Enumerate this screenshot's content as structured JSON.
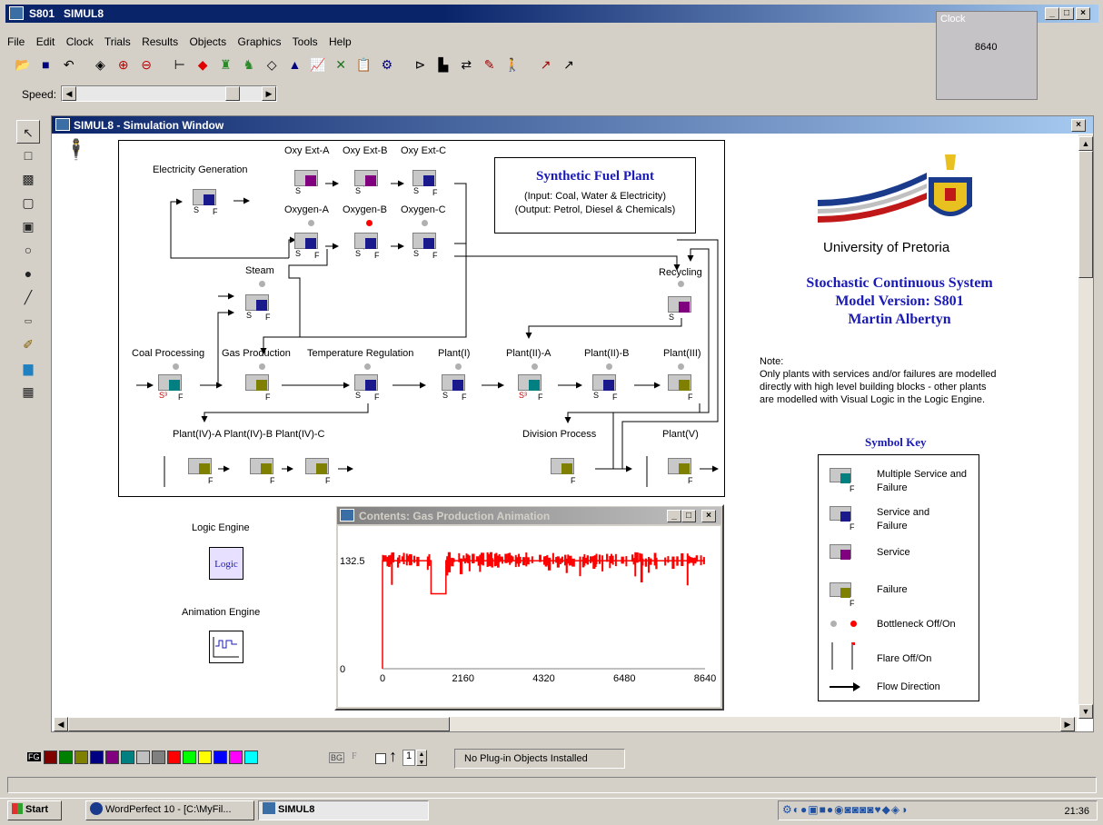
{
  "app": {
    "window_title": "S801   SIMUL8"
  },
  "clock": {
    "label": "Clock",
    "value": "8640"
  },
  "menu": [
    "File",
    "Edit",
    "Clock",
    "Trials",
    "Results",
    "Objects",
    "Graphics",
    "Tools",
    "Help"
  ],
  "speed": {
    "label": "Speed:"
  },
  "sim_window": {
    "title": "SIMUL8 - Simulation Window"
  },
  "plant": {
    "title": "Synthetic Fuel Plant",
    "input": "(Input: Coal, Water & Electricity)",
    "output": "(Output: Petrol, Diesel & Chemicals)"
  },
  "nodes": {
    "electricity": "Electricity Generation",
    "oxy_ext_a": "Oxy Ext-A",
    "oxy_ext_b": "Oxy Ext-B",
    "oxy_ext_c": "Oxy Ext-C",
    "oxygen_a": "Oxygen-A",
    "oxygen_b": "Oxygen-B",
    "oxygen_c": "Oxygen-C",
    "steam": "Steam",
    "recycling": "Recycling",
    "coal": "Coal Processing",
    "gas": "Gas Production",
    "temp": "Temperature Regulation",
    "plant1": "Plant(I)",
    "plant2a": "Plant(II)-A",
    "plant2b": "Plant(II)-B",
    "plant3": "Plant(III)",
    "plant4": "Plant(IV)-A Plant(IV)-B Plant(IV)-C",
    "division": "Division Process",
    "plant5": "Plant(V)"
  },
  "university": {
    "name": "University of Pretoria",
    "line1": "Stochastic Continuous System",
    "line2": "Model Version: S801",
    "line3": "Martin Albertyn"
  },
  "note": {
    "heading": "Note:",
    "l1": "Only plants with services and/or failures are modelled",
    "l2": "directly with high level building blocks - other plants",
    "l3": "are modelled with Visual Logic in the Logic Engine."
  },
  "symbol_key": {
    "title": "Symbol Key",
    "items": [
      "Multiple Service and Failure",
      "Service and Failure",
      "Service",
      "Failure",
      "Bottleneck Off/On",
      "Flare Off/On",
      "Flow Direction"
    ]
  },
  "engines": {
    "logic": "Logic Engine",
    "logic_icon": "Logic",
    "animation": "Animation Engine"
  },
  "chart_window": {
    "title": "Contents: Gas Production Animation"
  },
  "chart_data": {
    "type": "line",
    "title": "Contents: Gas Production Animation",
    "x_ticks": [
      "0",
      "2160",
      "4320",
      "6480",
      "8640"
    ],
    "y_ticks": [
      "0",
      "132.5"
    ],
    "xlim": [
      0,
      8640
    ],
    "ylim": [
      0,
      146
    ],
    "series_color": "#ff0000",
    "segments": [
      {
        "x": 0,
        "y": 0
      },
      {
        "x": 0,
        "y": 132.5
      },
      {
        "x": 1300,
        "y": 132.5
      },
      {
        "x": 1300,
        "y": 92
      },
      {
        "x": 1700,
        "y": 92
      },
      {
        "x": 1700,
        "y": 132.5
      },
      {
        "x": 8640,
        "y": 132.5
      }
    ]
  },
  "statusbar": {
    "plugin": "No Plug-in Objects Installed",
    "fg": "FG",
    "bg": "BG",
    "f": "F",
    "spin": "1"
  },
  "palette": [
    "#800000",
    "#008000",
    "#808000",
    "#000080",
    "#800080",
    "#008080",
    "#c0c0c0",
    "#808080",
    "#ff0000",
    "#00ff00",
    "#ffff00",
    "#0000ff",
    "#ff00ff",
    "#00ffff"
  ],
  "taskbar": {
    "start": "Start",
    "task1": "WordPerfect 10 - [C:\\MyFil...",
    "task2": "SIMUL8",
    "time": "21:36"
  }
}
